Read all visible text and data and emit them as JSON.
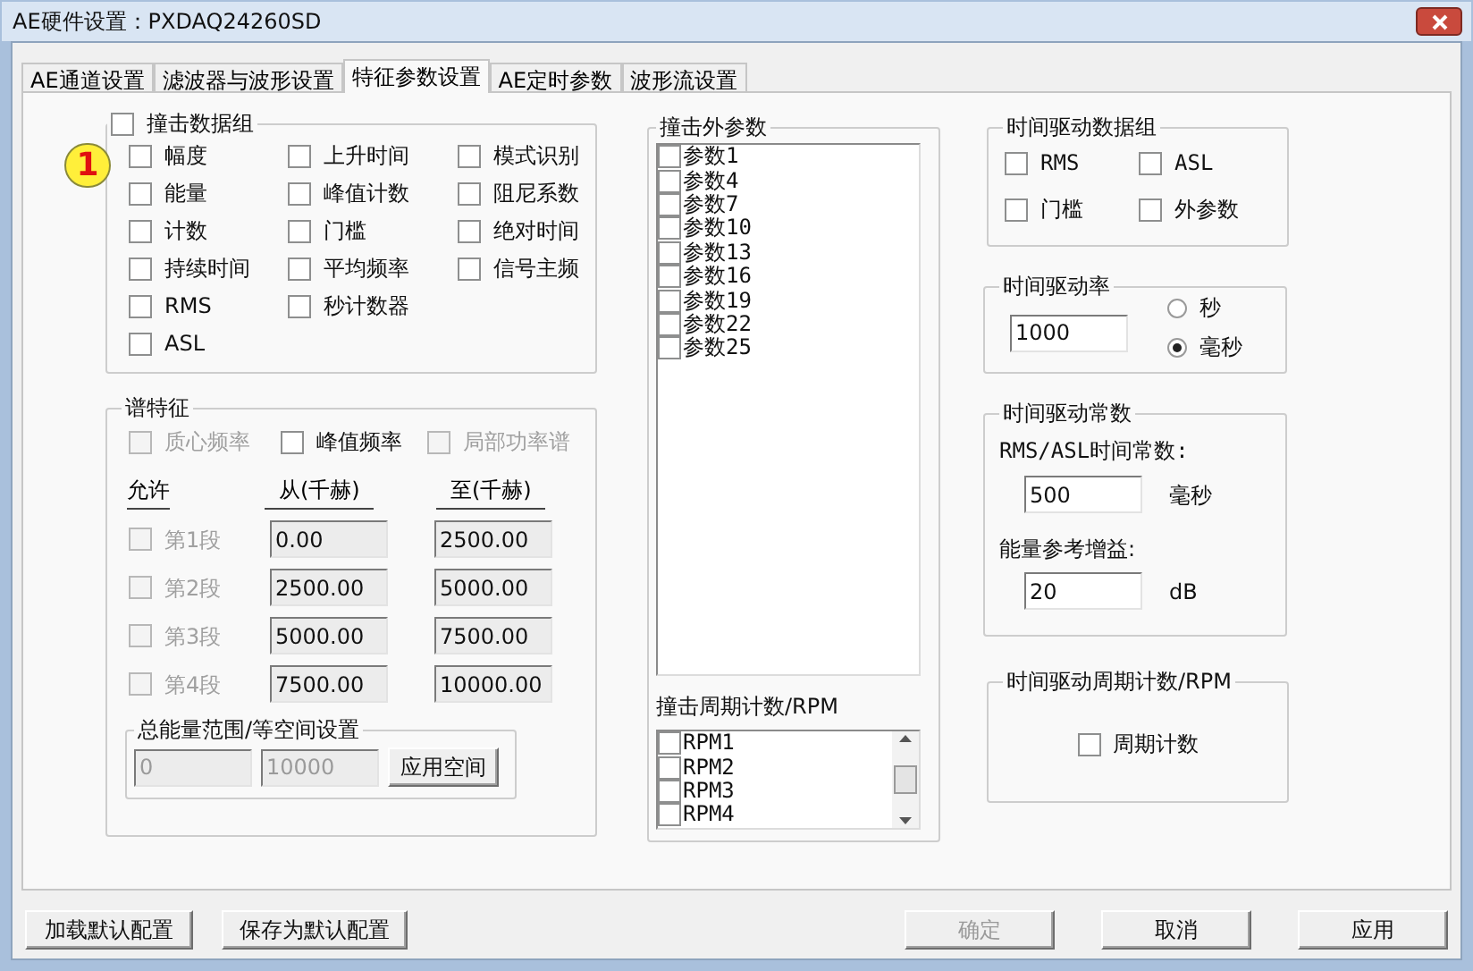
{
  "window": {
    "title": "AE硬件设置：PXDAQ24260SD"
  },
  "tabs": [
    {
      "label": "AE通道设置",
      "selected": false
    },
    {
      "label": "滤波器与波形设置",
      "selected": false
    },
    {
      "label": "特征参数设置",
      "selected": true
    },
    {
      "label": "AE定时参数",
      "selected": false
    },
    {
      "label": "波形流设置",
      "selected": false
    }
  ],
  "hit_data_group": {
    "label": "撞击数据组",
    "checked": false,
    "annotation": "1",
    "columns": [
      [
        {
          "label": "幅度",
          "checked": false
        },
        {
          "label": "能量",
          "checked": false
        },
        {
          "label": "计数",
          "checked": false
        },
        {
          "label": "持续时间",
          "checked": false
        },
        {
          "label": "RMS",
          "checked": false
        },
        {
          "label": "ASL",
          "checked": false
        }
      ],
      [
        {
          "label": "上升时间",
          "checked": false
        },
        {
          "label": "峰值计数",
          "checked": false
        },
        {
          "label": "门槛",
          "checked": false
        },
        {
          "label": "平均频率",
          "checked": false
        },
        {
          "label": "秒计数器",
          "checked": false
        }
      ],
      [
        {
          "label": "模式识别",
          "checked": false
        },
        {
          "label": "阻尼系数",
          "checked": false
        },
        {
          "label": "绝对时间",
          "checked": false
        },
        {
          "label": "信号主频",
          "checked": false
        }
      ]
    ]
  },
  "spectrum": {
    "label": "谱特征",
    "features": [
      {
        "label": "质心频率",
        "checked": false,
        "disabled": true
      },
      {
        "label": "峰值频率",
        "checked": false,
        "disabled": false
      },
      {
        "label": "局部功率谱",
        "checked": false,
        "disabled": true
      }
    ],
    "headers": [
      "允许",
      "从(千赫)",
      "至(千赫)"
    ],
    "bands": [
      {
        "label": "第1段",
        "checked": false,
        "disabled": true,
        "from": "0.00",
        "to": "2500.00"
      },
      {
        "label": "第2段",
        "checked": false,
        "disabled": true,
        "from": "2500.00",
        "to": "5000.00"
      },
      {
        "label": "第3段",
        "checked": false,
        "disabled": true,
        "from": "5000.00",
        "to": "7500.00"
      },
      {
        "label": "第4段",
        "checked": false,
        "disabled": true,
        "from": "7500.00",
        "to": "10000.00"
      }
    ],
    "energy_range": {
      "label": "总能量范围/等空间设置",
      "from": "0",
      "to": "10000",
      "disabled": true,
      "button": "应用空间"
    }
  },
  "hit_external": {
    "label": "撞击外参数",
    "items": [
      {
        "label": "参数1",
        "checked": false
      },
      {
        "label": "参数4",
        "checked": false
      },
      {
        "label": "参数7",
        "checked": false
      },
      {
        "label": "参数10",
        "checked": false
      },
      {
        "label": "参数13",
        "checked": false
      },
      {
        "label": "参数16",
        "checked": false
      },
      {
        "label": "参数19",
        "checked": false
      },
      {
        "label": "参数22",
        "checked": false
      },
      {
        "label": "参数25",
        "checked": false
      }
    ]
  },
  "hit_rpm": {
    "label": "撞击周期计数/RPM",
    "items": [
      {
        "label": "RPM1",
        "checked": false
      },
      {
        "label": "RPM2",
        "checked": false
      },
      {
        "label": "RPM3",
        "checked": false
      },
      {
        "label": "RPM4",
        "checked": false
      }
    ]
  },
  "time_driven_group": {
    "label": "时间驱动数据组",
    "items": [
      {
        "label": "RMS",
        "checked": false
      },
      {
        "label": "ASL",
        "checked": false
      },
      {
        "label": "门槛",
        "checked": false
      },
      {
        "label": "外参数",
        "checked": false
      }
    ]
  },
  "time_driven_rate": {
    "label": "时间驱动率",
    "value": "1000",
    "units": [
      {
        "label": "秒",
        "selected": false
      },
      {
        "label": "毫秒",
        "selected": true
      }
    ]
  },
  "time_constants": {
    "label": "时间驱动常数",
    "rms_label": "RMS/ASL时间常数:",
    "rms_value": "500",
    "rms_unit": "毫秒",
    "gain_label": "能量参考增益:",
    "gain_value": "20",
    "gain_unit": "dB"
  },
  "time_rpm": {
    "label": "时间驱动周期计数/RPM",
    "checkbox": {
      "label": "周期计数",
      "checked": false
    }
  },
  "left_buttons": [
    {
      "label": "加载默认配置",
      "disabled": false
    },
    {
      "label": "保存为默认配置",
      "disabled": false
    }
  ],
  "right_buttons": [
    {
      "label": "确定",
      "disabled": true
    },
    {
      "label": "取消",
      "disabled": false
    },
    {
      "label": "应用",
      "disabled": false
    }
  ]
}
